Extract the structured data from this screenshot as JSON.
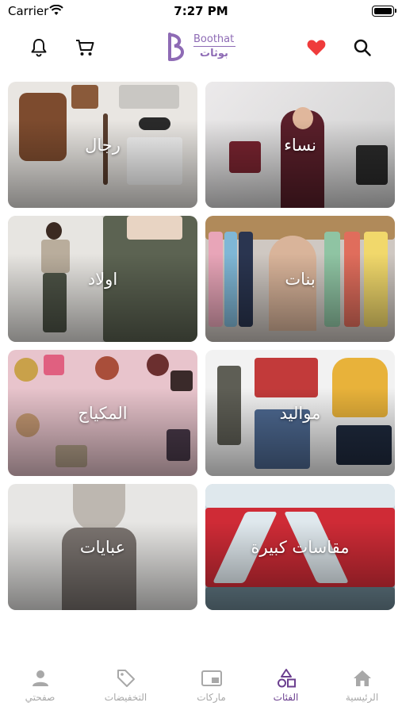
{
  "status": {
    "carrier": "Carrier",
    "time": "7:27 PM"
  },
  "logo": {
    "english": "Boothat",
    "arabic": "بوثات"
  },
  "colors": {
    "brand": "#8e6bb5",
    "heart": "#ef3b3b",
    "tab_active": "#6b3f8f",
    "tab_inactive": "#a8a8a8"
  },
  "header_icons": [
    "bell-icon",
    "cart-icon",
    "heart-icon",
    "search-icon"
  ],
  "categories": [
    {
      "label": "نساء"
    },
    {
      "label": "رجال"
    },
    {
      "label": "بنات"
    },
    {
      "label": "اولاد"
    },
    {
      "label": "مواليد"
    },
    {
      "label": "المكياج"
    },
    {
      "label": "مقاسات كبيرة"
    },
    {
      "label": "عبايات"
    }
  ],
  "tabs": [
    {
      "label": "صفحتي",
      "icon": "person-icon"
    },
    {
      "label": "التخفيضات",
      "icon": "tag-icon"
    },
    {
      "label": "ماركات",
      "icon": "brands-icon"
    },
    {
      "label": "الفئات",
      "icon": "categories-icon",
      "active": true
    },
    {
      "label": "الرئيسية",
      "icon": "home-icon"
    }
  ]
}
